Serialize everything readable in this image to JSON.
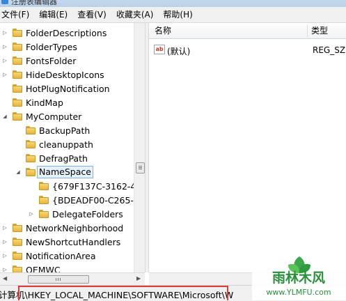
{
  "window": {
    "title": "注册表编辑器"
  },
  "menu": [
    "文件(F)",
    "编辑(E)",
    "查看(V)",
    "收藏夹(A)",
    "帮助(H)"
  ],
  "tree": {
    "items": [
      {
        "label": "FolderDescriptions",
        "depth": 0,
        "expander": "collapsed"
      },
      {
        "label": "FolderTypes",
        "depth": 0,
        "expander": "collapsed"
      },
      {
        "label": "FontsFolder",
        "depth": 0,
        "expander": "collapsed"
      },
      {
        "label": "HideDesktopIcons",
        "depth": 0,
        "expander": "collapsed"
      },
      {
        "label": "HotPlugNotification",
        "depth": 0,
        "expander": "none"
      },
      {
        "label": "KindMap",
        "depth": 0,
        "expander": "none"
      },
      {
        "label": "MyComputer",
        "depth": 0,
        "expander": "expanded"
      },
      {
        "label": "BackupPath",
        "depth": 1,
        "expander": "none"
      },
      {
        "label": "cleanuppath",
        "depth": 1,
        "expander": "none"
      },
      {
        "label": "DefragPath",
        "depth": 1,
        "expander": "none"
      },
      {
        "label": "NameSpace",
        "depth": 1,
        "expander": "expanded",
        "selected": true
      },
      {
        "label": "{679F137C-3162-4",
        "depth": 2,
        "expander": "none"
      },
      {
        "label": "{BDEADF00-C265-",
        "depth": 2,
        "expander": "none"
      },
      {
        "label": "DelegateFolders",
        "depth": 2,
        "expander": "collapsed"
      },
      {
        "label": "NetworkNeighborhood",
        "depth": 0,
        "expander": "collapsed"
      },
      {
        "label": "NewShortcutHandlers",
        "depth": 0,
        "expander": "collapsed"
      },
      {
        "label": "NotificationArea",
        "depth": 0,
        "expander": "collapsed"
      },
      {
        "label": "OEMWC",
        "depth": 0,
        "expander": "collapsed"
      }
    ]
  },
  "list": {
    "columns": {
      "name": "名称",
      "type": "类型"
    },
    "rows": [
      {
        "name": "(默认)",
        "type": "REG_SZ",
        "icon": "ab"
      }
    ]
  },
  "status": {
    "path": "计算机\\HKEY_LOCAL_MACHINE\\SOFTWARE\\Microsoft\\W"
  },
  "watermark": {
    "brand": "雨林木风",
    "url": "www.YLMFU.com"
  },
  "colors": {
    "selection_border": "#7fb3e6",
    "selection_fill": "#e5f1fb",
    "highlight_box": "#e03a3a",
    "folder": "#f3c85a"
  }
}
